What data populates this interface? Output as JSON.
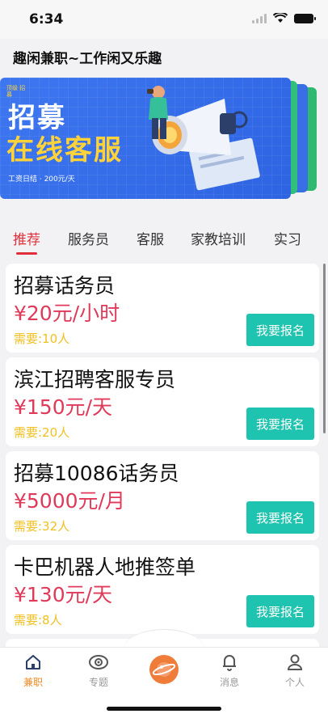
{
  "status": {
    "time": "6:34"
  },
  "app": {
    "title": "趣闲兼职~工作闲又乐趣"
  },
  "banner": {
    "badge": "顶级 招募",
    "line1": "招募",
    "line2": "在线客服",
    "sub": "工资日结 · 200元/天",
    "colors": {
      "main": "#3d77f0",
      "back1": "#2fc07a",
      "back2": "#3366e0",
      "accent": "#ffd23a"
    }
  },
  "tabs": [
    {
      "label": "推荐",
      "active": true
    },
    {
      "label": "服务员"
    },
    {
      "label": "客服"
    },
    {
      "label": "家教培训"
    },
    {
      "label": "实习"
    }
  ],
  "jobs": [
    {
      "title": "招募话务员",
      "price": "¥20元/小时",
      "need": "需要:10人",
      "action": "我要报名"
    },
    {
      "title": "滨江招聘客服专员",
      "price": "¥150元/天",
      "need": "需要:20人",
      "action": "我要报名"
    },
    {
      "title": "招募10086话务员",
      "price": "¥5000元/月",
      "need": "需要:32人",
      "action": "我要报名"
    },
    {
      "title": "卡巴机器人地推签单",
      "price": "¥130元/天",
      "need": "需要:8人",
      "action": "我要报名"
    }
  ],
  "tabbar": {
    "items": [
      {
        "label": "兼职",
        "icon": "home-icon",
        "active": true
      },
      {
        "label": "专题",
        "icon": "eye-icon"
      },
      {
        "label": "",
        "icon": "planet-icon"
      },
      {
        "label": "消息",
        "icon": "bell-icon"
      },
      {
        "label": "个人",
        "icon": "person-icon"
      }
    ]
  },
  "colors": {
    "accent": "#e02f3a",
    "price": "#e03a5a",
    "need": "#f0c020",
    "button": "#1ec4b0",
    "tab_active": "#f08a24"
  }
}
